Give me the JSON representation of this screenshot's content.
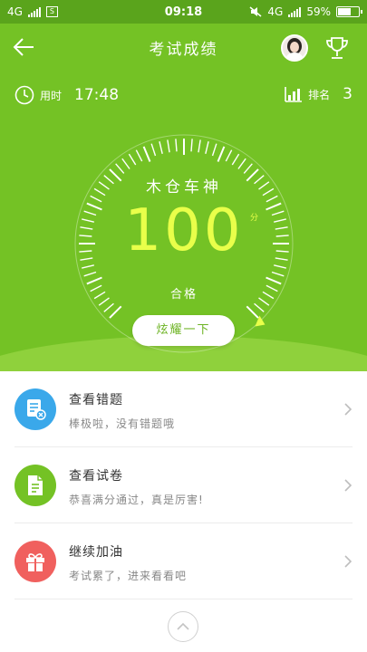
{
  "status_bar": {
    "network_left": "4G",
    "box_glyph": "S",
    "time": "09:18",
    "network_right": "4G",
    "battery": "59%",
    "battery_level": 0.59
  },
  "header": {
    "title": "考试成绩",
    "back_icon": "arrow-left-icon",
    "trophy_icon": "trophy-icon"
  },
  "stats": {
    "time_label": "用时",
    "time_value": "17:48",
    "rank_label": "排名",
    "rank_value": "3"
  },
  "result": {
    "nickname": "木仓车神",
    "score": "100",
    "score_unit": "分",
    "score_fraction": 1.0,
    "verdict": "合格"
  },
  "show_off_button": "炫耀一下",
  "list": [
    {
      "title": "查看错题",
      "desc": "棒极啦，没有错题哦",
      "icon": "wrong-questions-icon",
      "color": "#3aa8ea"
    },
    {
      "title": "查看试卷",
      "desc": "恭喜满分通过，真是厉害!",
      "icon": "paper-icon",
      "color": "#74c225"
    },
    {
      "title": "继续加油",
      "desc": "考试累了，进来看看吧",
      "icon": "gift-icon",
      "color": "#f0605e"
    }
  ],
  "colors": {
    "brand_green": "#74c225",
    "status_green": "#5aa41c",
    "score_yellow": "#e9ff4a"
  }
}
